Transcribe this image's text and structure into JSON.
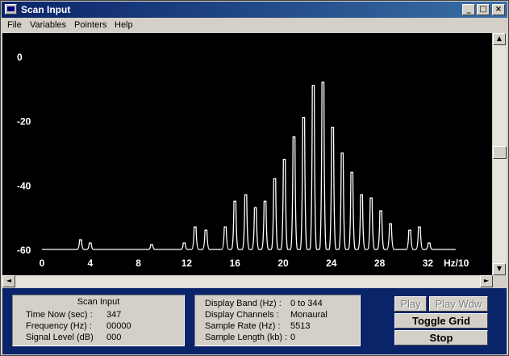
{
  "window": {
    "title": "Scan Input"
  },
  "titlebar_buttons": {
    "minimize": "_",
    "maximize": "□",
    "close": "×"
  },
  "menu": [
    {
      "label": "File"
    },
    {
      "label": "Variables"
    },
    {
      "label": "Pointers"
    },
    {
      "label": "Help"
    }
  ],
  "chart_data": {
    "type": "line",
    "title": "",
    "xlabel": "Hz/10",
    "ylabel": "",
    "xlim": [
      0,
      37
    ],
    "ylim": [
      -60,
      5
    ],
    "x_ticks": [
      0,
      4,
      8,
      12,
      16,
      20,
      24,
      28,
      32
    ],
    "y_ticks": [
      0,
      -20,
      -40,
      -60
    ],
    "grid": false,
    "color": "#ffffff",
    "peaks": [
      {
        "x": 3.2,
        "y": -57
      },
      {
        "x": 4.0,
        "y": -58
      },
      {
        "x": 9.1,
        "y": -58.5
      },
      {
        "x": 11.8,
        "y": -58
      },
      {
        "x": 12.7,
        "y": -53
      },
      {
        "x": 13.6,
        "y": -54
      },
      {
        "x": 15.2,
        "y": -53
      },
      {
        "x": 16.0,
        "y": -45
      },
      {
        "x": 16.9,
        "y": -43
      },
      {
        "x": 17.7,
        "y": -47
      },
      {
        "x": 18.5,
        "y": -45
      },
      {
        "x": 19.3,
        "y": -38
      },
      {
        "x": 20.1,
        "y": -32
      },
      {
        "x": 20.9,
        "y": -25
      },
      {
        "x": 21.7,
        "y": -19
      },
      {
        "x": 22.5,
        "y": -9
      },
      {
        "x": 23.3,
        "y": -8
      },
      {
        "x": 24.1,
        "y": -22
      },
      {
        "x": 24.9,
        "y": -30
      },
      {
        "x": 25.7,
        "y": -36
      },
      {
        "x": 26.5,
        "y": -43
      },
      {
        "x": 27.3,
        "y": -44
      },
      {
        "x": 28.1,
        "y": -48
      },
      {
        "x": 28.9,
        "y": -52
      },
      {
        "x": 30.5,
        "y": -54
      },
      {
        "x": 31.3,
        "y": -53
      },
      {
        "x": 32.1,
        "y": -58
      }
    ],
    "baseline": -60,
    "x_range_drawn": [
      0,
      34.3
    ]
  },
  "scan_panel": {
    "title": "Scan Input",
    "rows": [
      {
        "label": "Time Now (sec) :",
        "value": "347"
      },
      {
        "label": "Frequency (Hz) :",
        "value": "00000"
      },
      {
        "label": "Signal Level (dB)",
        "value": "000"
      }
    ]
  },
  "display_panel": {
    "rows": [
      {
        "label": "Display Band (Hz) :",
        "value": "0 to 344"
      },
      {
        "label": "Display Channels :",
        "value": "Monaural"
      },
      {
        "label": "Sample Rate (Hz) :",
        "value": "5513"
      },
      {
        "label": "Sample Length (kb) :",
        "value": "0"
      }
    ]
  },
  "buttons": {
    "play": "Play",
    "play_wdw": "Play Wdw",
    "toggle_grid": "Toggle Grid",
    "stop": "Stop"
  },
  "scroll": {
    "up": "▲",
    "down": "▼",
    "left": "◄",
    "right": "►"
  }
}
